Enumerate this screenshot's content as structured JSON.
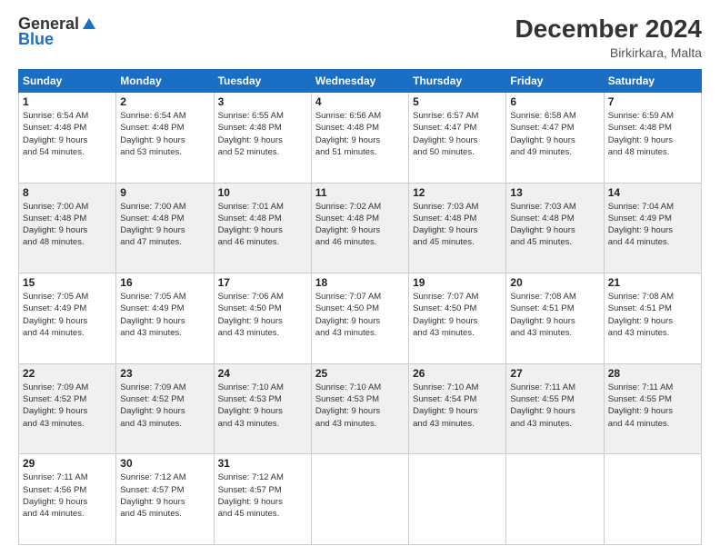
{
  "header": {
    "logo_general": "General",
    "logo_blue": "Blue",
    "month_title": "December 2024",
    "location": "Birkirkara, Malta"
  },
  "weekdays": [
    "Sunday",
    "Monday",
    "Tuesday",
    "Wednesday",
    "Thursday",
    "Friday",
    "Saturday"
  ],
  "weeks": [
    [
      {
        "day": "1",
        "info": "Sunrise: 6:54 AM\nSunset: 4:48 PM\nDaylight: 9 hours\nand 54 minutes."
      },
      {
        "day": "2",
        "info": "Sunrise: 6:54 AM\nSunset: 4:48 PM\nDaylight: 9 hours\nand 53 minutes."
      },
      {
        "day": "3",
        "info": "Sunrise: 6:55 AM\nSunset: 4:48 PM\nDaylight: 9 hours\nand 52 minutes."
      },
      {
        "day": "4",
        "info": "Sunrise: 6:56 AM\nSunset: 4:48 PM\nDaylight: 9 hours\nand 51 minutes."
      },
      {
        "day": "5",
        "info": "Sunrise: 6:57 AM\nSunset: 4:47 PM\nDaylight: 9 hours\nand 50 minutes."
      },
      {
        "day": "6",
        "info": "Sunrise: 6:58 AM\nSunset: 4:47 PM\nDaylight: 9 hours\nand 49 minutes."
      },
      {
        "day": "7",
        "info": "Sunrise: 6:59 AM\nSunset: 4:48 PM\nDaylight: 9 hours\nand 48 minutes."
      }
    ],
    [
      {
        "day": "8",
        "info": "Sunrise: 7:00 AM\nSunset: 4:48 PM\nDaylight: 9 hours\nand 48 minutes."
      },
      {
        "day": "9",
        "info": "Sunrise: 7:00 AM\nSunset: 4:48 PM\nDaylight: 9 hours\nand 47 minutes."
      },
      {
        "day": "10",
        "info": "Sunrise: 7:01 AM\nSunset: 4:48 PM\nDaylight: 9 hours\nand 46 minutes."
      },
      {
        "day": "11",
        "info": "Sunrise: 7:02 AM\nSunset: 4:48 PM\nDaylight: 9 hours\nand 46 minutes."
      },
      {
        "day": "12",
        "info": "Sunrise: 7:03 AM\nSunset: 4:48 PM\nDaylight: 9 hours\nand 45 minutes."
      },
      {
        "day": "13",
        "info": "Sunrise: 7:03 AM\nSunset: 4:48 PM\nDaylight: 9 hours\nand 45 minutes."
      },
      {
        "day": "14",
        "info": "Sunrise: 7:04 AM\nSunset: 4:49 PM\nDaylight: 9 hours\nand 44 minutes."
      }
    ],
    [
      {
        "day": "15",
        "info": "Sunrise: 7:05 AM\nSunset: 4:49 PM\nDaylight: 9 hours\nand 44 minutes."
      },
      {
        "day": "16",
        "info": "Sunrise: 7:05 AM\nSunset: 4:49 PM\nDaylight: 9 hours\nand 43 minutes."
      },
      {
        "day": "17",
        "info": "Sunrise: 7:06 AM\nSunset: 4:50 PM\nDaylight: 9 hours\nand 43 minutes."
      },
      {
        "day": "18",
        "info": "Sunrise: 7:07 AM\nSunset: 4:50 PM\nDaylight: 9 hours\nand 43 minutes."
      },
      {
        "day": "19",
        "info": "Sunrise: 7:07 AM\nSunset: 4:50 PM\nDaylight: 9 hours\nand 43 minutes."
      },
      {
        "day": "20",
        "info": "Sunrise: 7:08 AM\nSunset: 4:51 PM\nDaylight: 9 hours\nand 43 minutes."
      },
      {
        "day": "21",
        "info": "Sunrise: 7:08 AM\nSunset: 4:51 PM\nDaylight: 9 hours\nand 43 minutes."
      }
    ],
    [
      {
        "day": "22",
        "info": "Sunrise: 7:09 AM\nSunset: 4:52 PM\nDaylight: 9 hours\nand 43 minutes."
      },
      {
        "day": "23",
        "info": "Sunrise: 7:09 AM\nSunset: 4:52 PM\nDaylight: 9 hours\nand 43 minutes."
      },
      {
        "day": "24",
        "info": "Sunrise: 7:10 AM\nSunset: 4:53 PM\nDaylight: 9 hours\nand 43 minutes."
      },
      {
        "day": "25",
        "info": "Sunrise: 7:10 AM\nSunset: 4:53 PM\nDaylight: 9 hours\nand 43 minutes."
      },
      {
        "day": "26",
        "info": "Sunrise: 7:10 AM\nSunset: 4:54 PM\nDaylight: 9 hours\nand 43 minutes."
      },
      {
        "day": "27",
        "info": "Sunrise: 7:11 AM\nSunset: 4:55 PM\nDaylight: 9 hours\nand 43 minutes."
      },
      {
        "day": "28",
        "info": "Sunrise: 7:11 AM\nSunset: 4:55 PM\nDaylight: 9 hours\nand 44 minutes."
      }
    ],
    [
      {
        "day": "29",
        "info": "Sunrise: 7:11 AM\nSunset: 4:56 PM\nDaylight: 9 hours\nand 44 minutes."
      },
      {
        "day": "30",
        "info": "Sunrise: 7:12 AM\nSunset: 4:57 PM\nDaylight: 9 hours\nand 45 minutes."
      },
      {
        "day": "31",
        "info": "Sunrise: 7:12 AM\nSunset: 4:57 PM\nDaylight: 9 hours\nand 45 minutes."
      },
      {
        "day": "",
        "info": ""
      },
      {
        "day": "",
        "info": ""
      },
      {
        "day": "",
        "info": ""
      },
      {
        "day": "",
        "info": ""
      }
    ]
  ]
}
